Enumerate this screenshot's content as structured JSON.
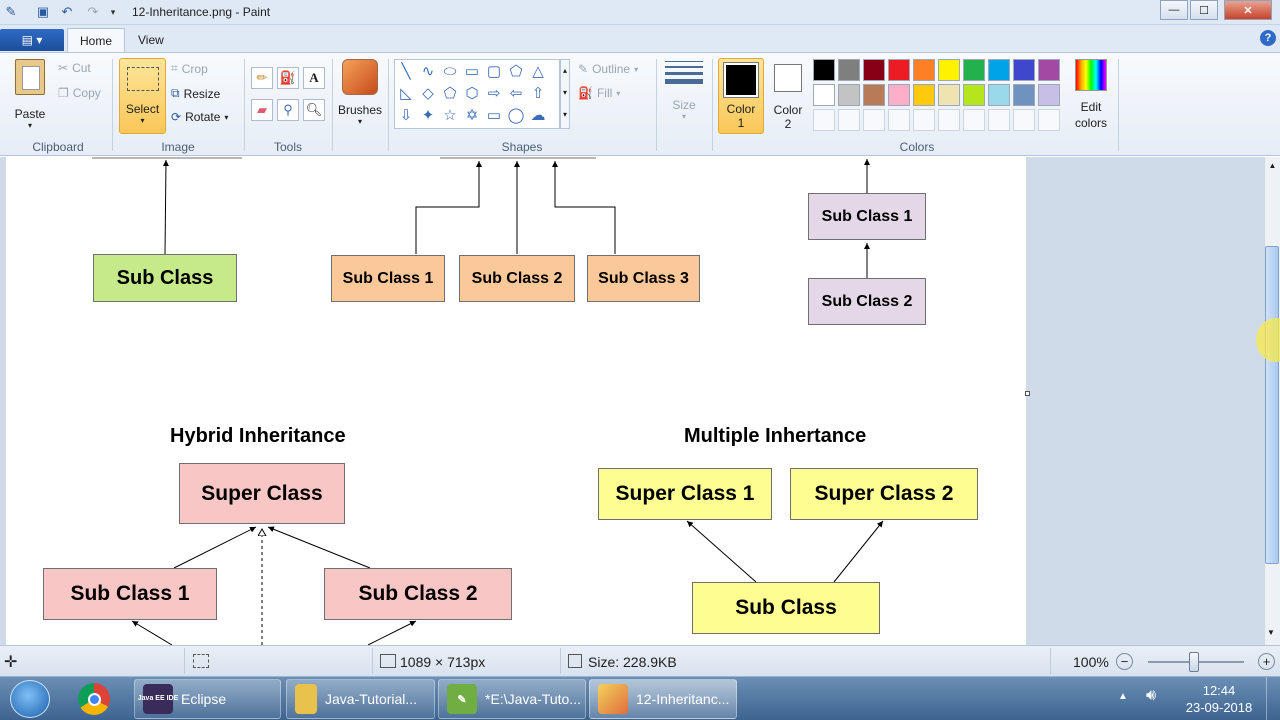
{
  "window": {
    "title": "12-Inheritance.png - Paint",
    "minimize": "—",
    "maximize": "☐",
    "close": "✕"
  },
  "tabs": {
    "file": "▤ ▾",
    "home": "Home",
    "view": "View"
  },
  "ribbon": {
    "clipboard": {
      "paste": "Paste",
      "cut": "Cut",
      "copy": "Copy",
      "group": "Clipboard"
    },
    "image": {
      "select": "Select",
      "crop": "Crop",
      "resize": "Resize",
      "rotate": "Rotate",
      "group": "Image"
    },
    "tools": {
      "group": "Tools"
    },
    "brushes": {
      "label": "Brushes"
    },
    "shapes": {
      "outline": "Outline",
      "fill": "Fill",
      "group": "Shapes"
    },
    "size": {
      "label": "Size"
    },
    "colors": {
      "color1": "Color",
      "color1_num": "1",
      "color2": "Color",
      "color2_num": "2",
      "edit1": "Edit",
      "edit2": "colors",
      "group": "Colors",
      "row1": [
        "#000000",
        "#7f7f7f",
        "#880015",
        "#ed1c24",
        "#ff7f27",
        "#fff200",
        "#22b14c",
        "#00a2e8",
        "#3f48cc",
        "#a349a4"
      ],
      "row2": [
        "#ffffff",
        "#c3c3c3",
        "#b97a57",
        "#ffaec9",
        "#ffc90e",
        "#efe4b0",
        "#b5e61d",
        "#99d9ea",
        "#7092be",
        "#c8bfe7"
      ]
    }
  },
  "diagram": {
    "single_sub": "Sub Class",
    "hier_sub1": "Sub Class 1",
    "hier_sub2": "Sub Class 2",
    "hier_sub3": "Sub Class 3",
    "multi_sub1": "Sub Class 1",
    "multi_sub2": "Sub Class 2",
    "hybrid_title": "Hybrid Inheritance",
    "hybrid_super": "Super Class",
    "hybrid_sub1": "Sub Class 1",
    "hybrid_sub2": "Sub Class 2",
    "multiple_title": "Multiple Inhertance",
    "multiple_super1": "Super Class 1",
    "multiple_super2": "Super Class 2",
    "multiple_sub": "Sub Class"
  },
  "statusbar": {
    "dimensions": "1089 × 713px",
    "size": "Size: 228.9KB",
    "zoom": "100%"
  },
  "taskbar": {
    "eclipse": "Eclipse",
    "explorer": "Java-Tutorial...",
    "notepad": "*E:\\Java-Tuto...",
    "paint": "12-Inheritanc...",
    "time": "12:44",
    "date": "23-09-2018",
    "eclipse_icon_text": "Java EE IDE"
  }
}
